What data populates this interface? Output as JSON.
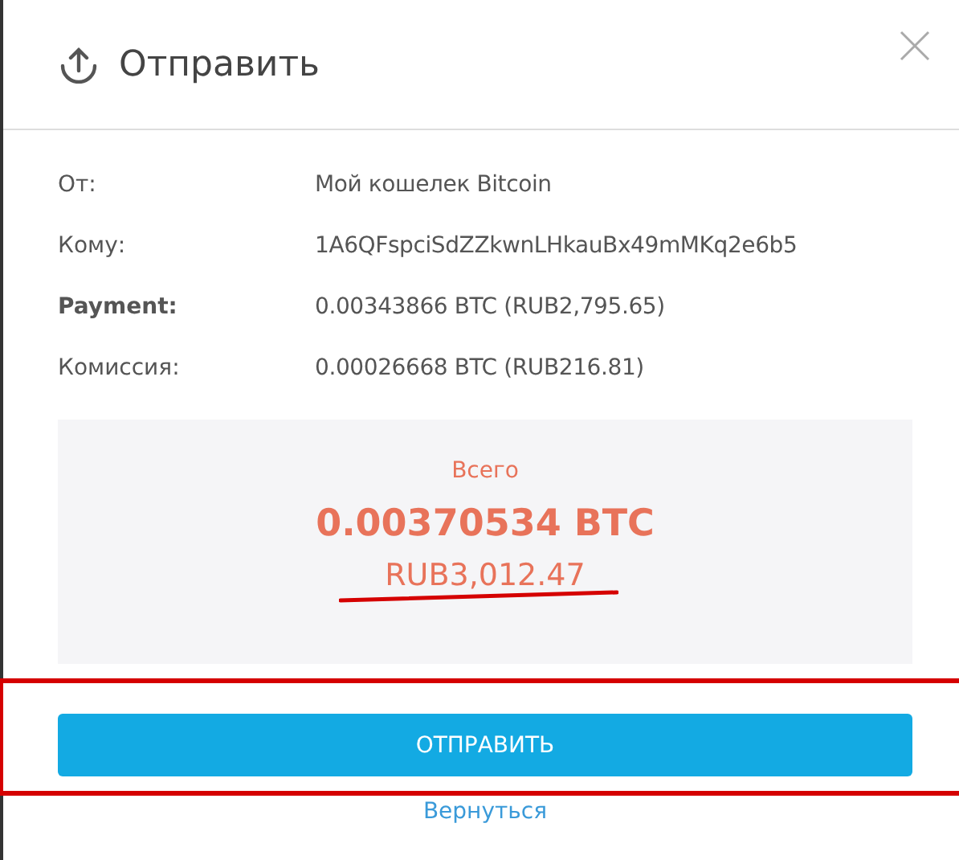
{
  "dialog": {
    "title": "Отправить"
  },
  "details": [
    {
      "label": "От:",
      "value": "Мой кошелек Bitcoin",
      "bold": false
    },
    {
      "label": "Кому:",
      "value": "1A6QFspciSdZZkwnLHkauBx49mMKq2e6b5",
      "bold": false
    },
    {
      "label": "Payment:",
      "value": "0.00343866 BTC  (RUB2,795.65)",
      "bold": true
    },
    {
      "label": "Комиссия:",
      "value": "0.00026668 BTC  (RUB216.81)",
      "bold": false
    }
  ],
  "total": {
    "label": "Всего",
    "amount": "0.00370534 BTC",
    "fiat": "RUB3,012.47"
  },
  "send_button": "ОТПРАВИТЬ",
  "back_link": "Вернуться"
}
